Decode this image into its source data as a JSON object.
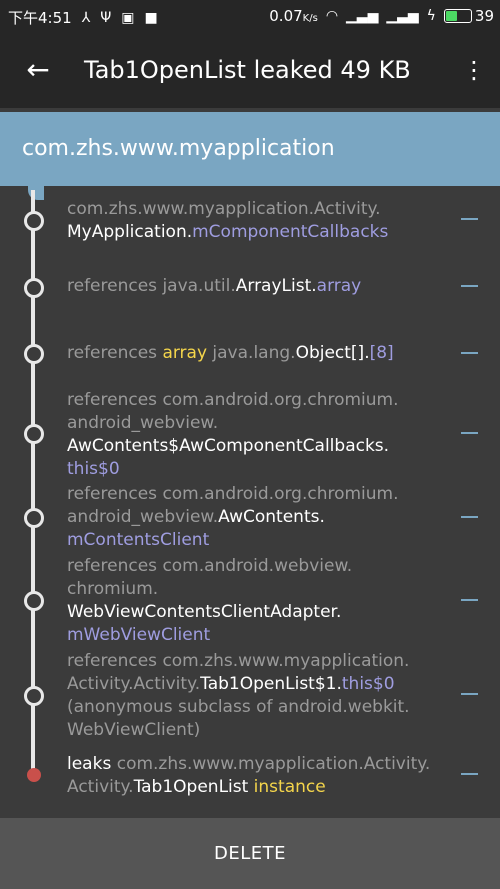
{
  "status": {
    "time": "下午4:51",
    "speed": "0.07",
    "speed_unit": "K/s",
    "battery": "39"
  },
  "appbar": {
    "back": "←",
    "title": "Tab1OpenList leaked 49 KB",
    "menu": "⋮"
  },
  "header": {
    "package": "com.zhs.www.myapplication"
  },
  "rows": [
    {
      "t1": "com.zhs.www.myapplication.Activity.",
      "t2": "MyApplication",
      "t3": ".",
      "t4": "mComponentCallbacks"
    },
    {
      "t1": "references ",
      "t2": "java.util.",
      "t3": "ArrayList",
      "t4": ".",
      "t5": "array"
    },
    {
      "t1": "references ",
      "t2": "array",
      "t3": " java.lang.",
      "t4": "Object[]",
      "t5": ".",
      "t6": "[8]"
    },
    {
      "t1": "references ",
      "t2": "com.android.org.chromium.",
      "t3": "android_webview.",
      "t4": "AwContents$AwComponentCallbacks",
      "t5": ".",
      "t6": "this$0"
    },
    {
      "t1": "references ",
      "t2": "com.android.org.chromium.",
      "t3": "android_webview.",
      "t4": "AwContents",
      "t5": ".",
      "t6": "mContentsClient"
    },
    {
      "t1": "references ",
      "t2": "com.android.webview.",
      "t3": "chromium.",
      "t4": "WebViewContentsClientAdapter",
      "t5": ".",
      "t6": "mWebViewClient"
    },
    {
      "t1": "references ",
      "t2": "com.zhs.www.myapplication.",
      "t3": "Activity.Activity.",
      "t4": "Tab1OpenList$1",
      "t5": ".",
      "t6": "this$0",
      "t7": "(anonymous subclass of android.webkit.",
      "t8": "WebViewClient)"
    },
    {
      "t1": "leaks ",
      "t2": "com.zhs.www.myapplication.Activity.",
      "t3": "Activity.",
      "t4": "Tab1OpenList",
      "t5": " instance"
    }
  ],
  "footer": {
    "delete_label": "DELETE"
  },
  "colors": {
    "accent": "#7aa6c2",
    "leak_dot": "#c9504b",
    "field": "#9f9de0",
    "highlight": "#f4d54b"
  }
}
